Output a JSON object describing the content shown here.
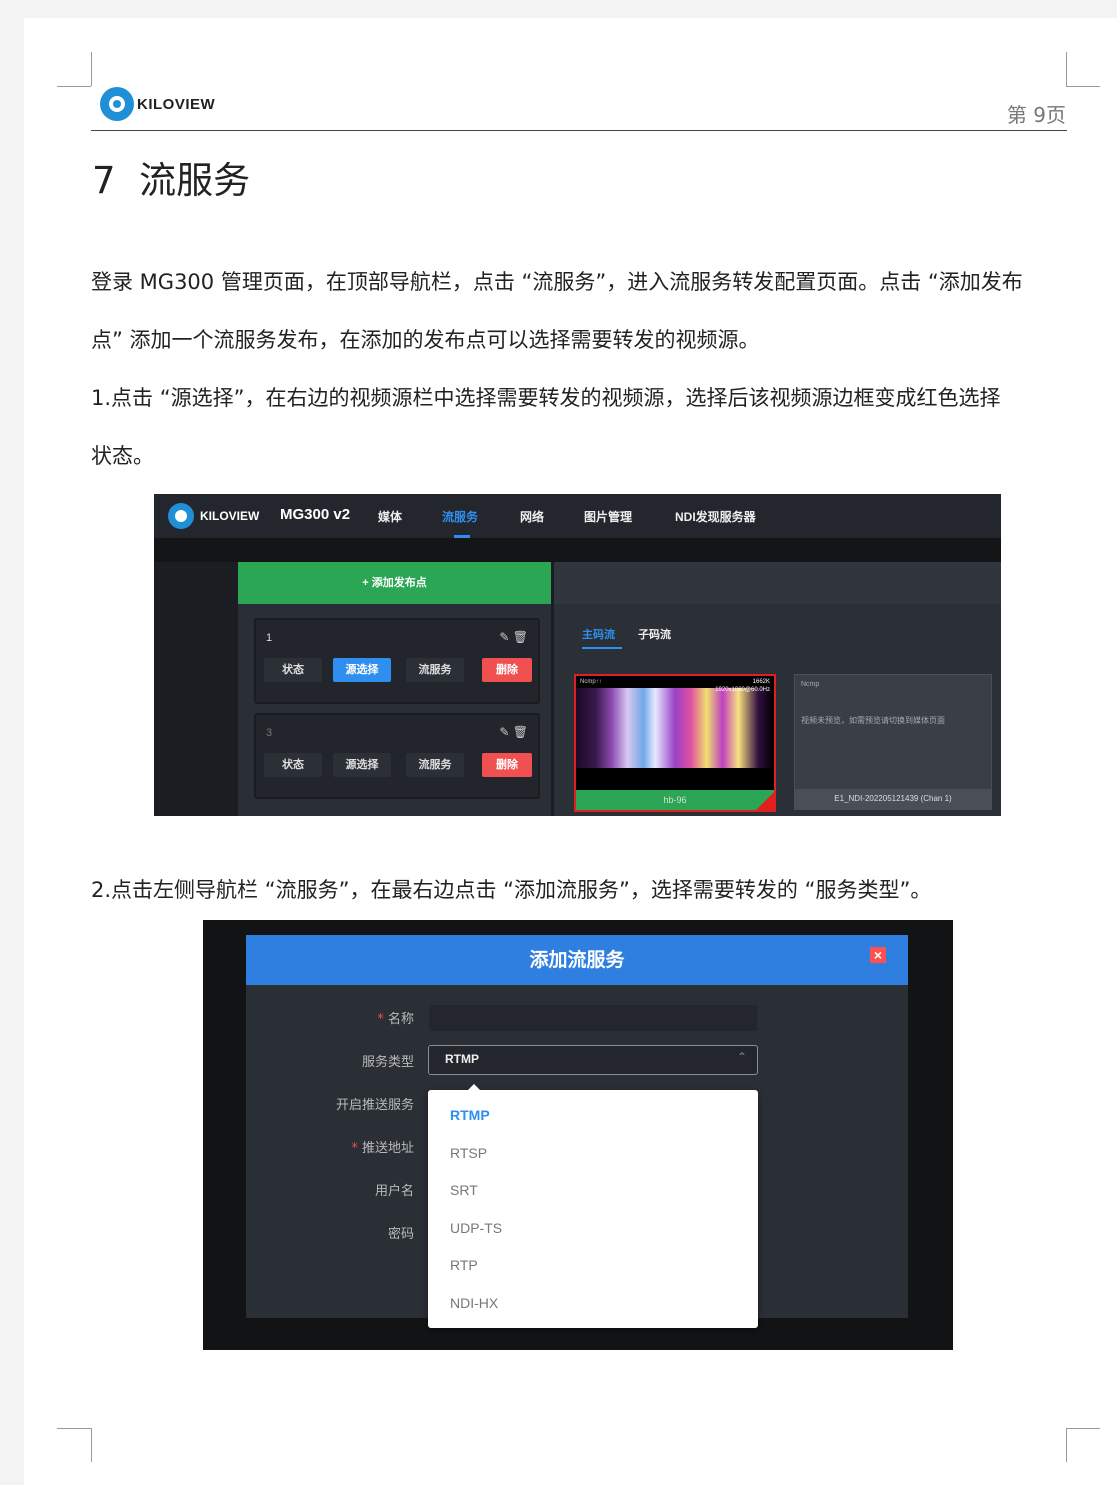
{
  "header": {
    "brand": "KILOVIEW",
    "page_number": "第 9页"
  },
  "heading": {
    "number": "7",
    "title": "流服务"
  },
  "paragraphs": {
    "intro_line1": "登录 MG300 管理页面，在顶部导航栏，点击 “流服务”，进入流服务转发配置页面。点击 “添加发布",
    "intro_line2": "点” 添加一个流服务发布，在添加的发布点可以选择需要转发的视频源。",
    "step1_line1": "1.点击 “源选择”，在右边的视频源栏中选择需要转发的视频源，选择后该视频源边框变成红色选择",
    "step1_line2": "状态。",
    "step2": "2.点击左侧导航栏 “流服务”，在最右边点击 “添加流服务”，选择需要转发的 “服务类型”。"
  },
  "screenshot1": {
    "brand": "KILOVIEW",
    "product": "MG300 v2",
    "nav": [
      "媒体",
      "流服务",
      "网络",
      "图片管理",
      "NDI发现服务器"
    ],
    "nav_active": "流服务",
    "add_button": "+ 添加发布点",
    "cards": [
      {
        "number": "1",
        "buttons": [
          "状态",
          "源选择",
          "流服务",
          "删除"
        ]
      },
      {
        "number": "3",
        "buttons": [
          "状态",
          "源选择",
          "流服务",
          "删除"
        ]
      }
    ],
    "tabs": [
      "主码流",
      "子码流"
    ],
    "sources": [
      {
        "label": "hb-96",
        "meta_top": "1662K",
        "meta_bottom": "1920x1080@60.0Hz",
        "corner": "Ncmp↑↑",
        "selected": true
      },
      {
        "label": "E1_NDI-202205121439 (Chan 1)",
        "corner": "Ncmp",
        "message": "视频未预览，如需预览请切换到媒体页面",
        "selected": false
      }
    ],
    "colors": {
      "accent": "#2f8ff0",
      "add": "#2aa654",
      "danger": "#f05050"
    }
  },
  "screenshot2": {
    "dialog_title": "添加流服务",
    "labels": {
      "name": "名称",
      "service_type": "服务类型",
      "push_service": "开启推送服务",
      "push_address": "推送地址",
      "username": "用户名",
      "password": "密码"
    },
    "required_mark": "*",
    "selected_value": "RTMP",
    "options": [
      "RTMP",
      "RTSP",
      "SRT",
      "UDP-TS",
      "RTP",
      "NDI-HX"
    ]
  }
}
